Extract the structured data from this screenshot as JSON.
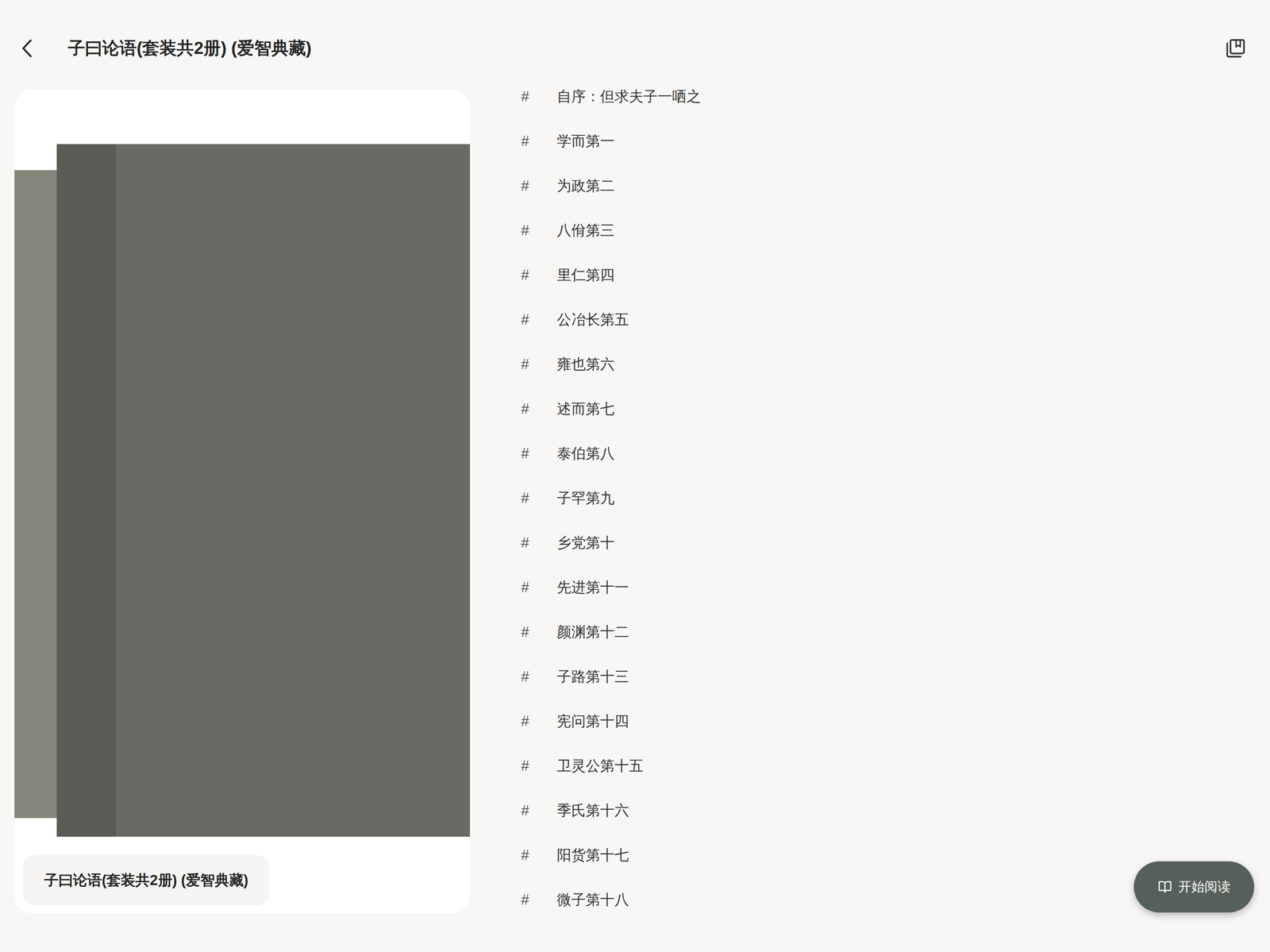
{
  "header": {
    "title": "子曰论语(套装共2册) (爱智典藏)"
  },
  "book": {
    "caption": "子曰论语(套装共2册) (爱智典藏)"
  },
  "toc": {
    "marker": "#",
    "items": [
      "自序：但求夫子一哂之",
      "学而第一",
      "为政第二",
      "八佾第三",
      "里仁第四",
      "公冶长第五",
      "雍也第六",
      "述而第七",
      "泰伯第八",
      "子罕第九",
      "乡党第十",
      "先进第十一",
      "颜渊第十二",
      "子路第十三",
      "宪问第十四",
      "卫灵公第十五",
      "季氏第十六",
      "阳货第十七",
      "微子第十八"
    ]
  },
  "action": {
    "label": "开始阅读"
  }
}
